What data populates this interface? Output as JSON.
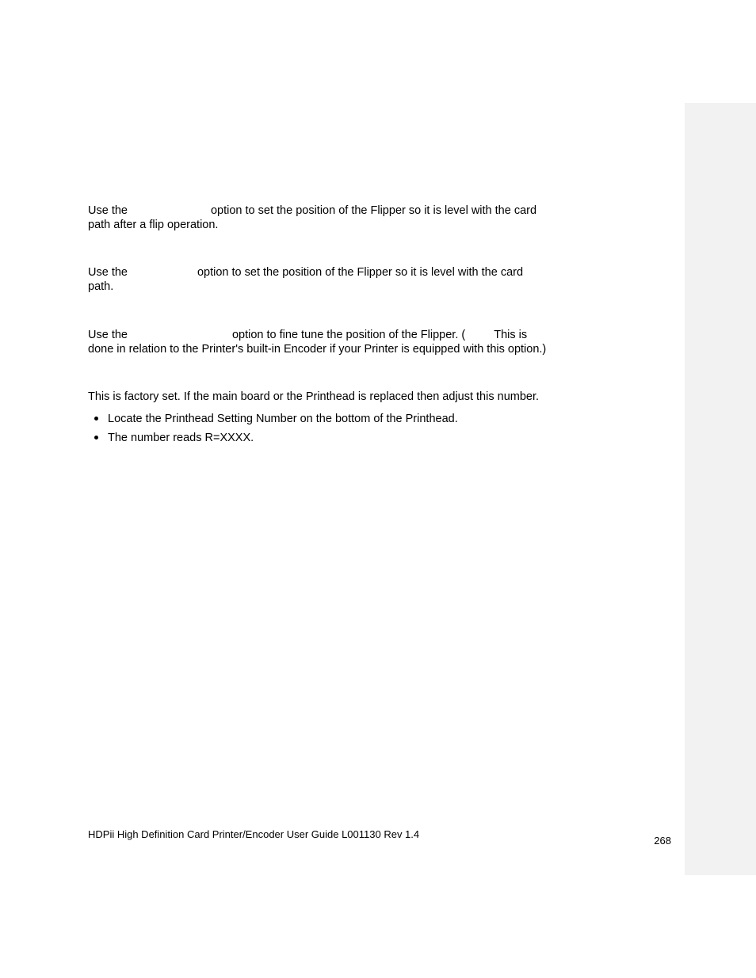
{
  "sections": {
    "s1": {
      "t1": "Use the",
      "t2": "option to set the position of the Flipper so it is level with the card",
      "t3": "path after a flip operation."
    },
    "s2": {
      "t1": "Use the",
      "t2": "option to set the position of the Flipper so it is level with the card",
      "t3": "path."
    },
    "s3": {
      "t1": "Use the",
      "t2": "option to fine tune the position of the Flipper. (",
      "t3": "This is",
      "t4": "done in relation to the Printer's built-in Encoder if your Printer is equipped with this option.)"
    },
    "s4": {
      "t1": "This is factory set. If the main board or the Printhead is replaced then adjust this number.",
      "b1": "Locate the Printhead Setting Number on the bottom of the Printhead.",
      "b2": "The number reads R=XXXX."
    }
  },
  "footer": {
    "left": "HDPii High Definition Card Printer/Encoder User Guide    L001130 Rev 1.4",
    "right": "268"
  }
}
